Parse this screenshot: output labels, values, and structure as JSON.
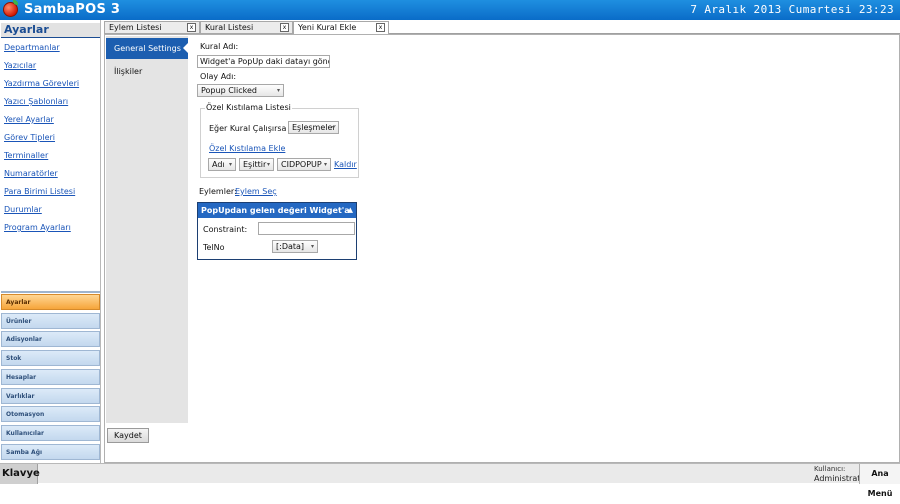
{
  "app": {
    "title": "SambaPOS 3",
    "datetime": "7 Aralık 2013 Cumartesi 23:23"
  },
  "sidebar": {
    "header": "Ayarlar",
    "links": [
      "Departmanlar",
      "Yazıcılar",
      "Yazdırma Görevleri",
      "Yazıcı Şablonları",
      "Yerel Ayarlar",
      "Görev Tipleri",
      "Terminaller",
      "Numaratörler",
      "Para Birimi Listesi",
      "Durumlar",
      "Program Ayarları"
    ],
    "nav": [
      "Ayarlar",
      "Ürünler",
      "Adisyonlar",
      "Stok",
      "Hesaplar",
      "Varlıklar",
      "Otomasyon",
      "Kullanıcılar",
      "Samba Ağı"
    ]
  },
  "tabs": [
    {
      "label": "Eylem Listesi",
      "close": "x"
    },
    {
      "label": "Kural Listesi",
      "close": "x"
    },
    {
      "label": "Yeni Kural Ekle",
      "close": "x"
    }
  ],
  "left": {
    "general": "General Settings",
    "relations": "İlişkiler"
  },
  "form": {
    "rule_name_label": "Kural Adı:",
    "rule_name_value": "Widget'a PopUp daki datayı gönder",
    "event_label": "Olay Adı:",
    "event_value": "Popup Clicked",
    "constraints_title": "Özel Kıstılama Listesi",
    "match_label": "Eğer Kural Çalışırsa",
    "match_value": "Eşleşmeler",
    "add_constraint": "Özel Kıstılama Ekle",
    "c_field": "Adı",
    "c_op": "Eşittir",
    "c_value": "CIDPOPUP",
    "remove": "Kaldır",
    "actions_label": "Eylemler:",
    "select_action": "Eylem Seç"
  },
  "action_panel": {
    "title": "PopUpdan gelen değeri Widget'a ata",
    "constraint_label": "Constraint:",
    "constraint_value": "",
    "telno_label": "TelNo",
    "telno_value": "[:Data]"
  },
  "save_button": "Kaydet",
  "status": {
    "keyboard": "Klavye",
    "user_label": "Kullanıcı:",
    "user_name": "Administrator",
    "main_menu": "Ana Menü"
  }
}
